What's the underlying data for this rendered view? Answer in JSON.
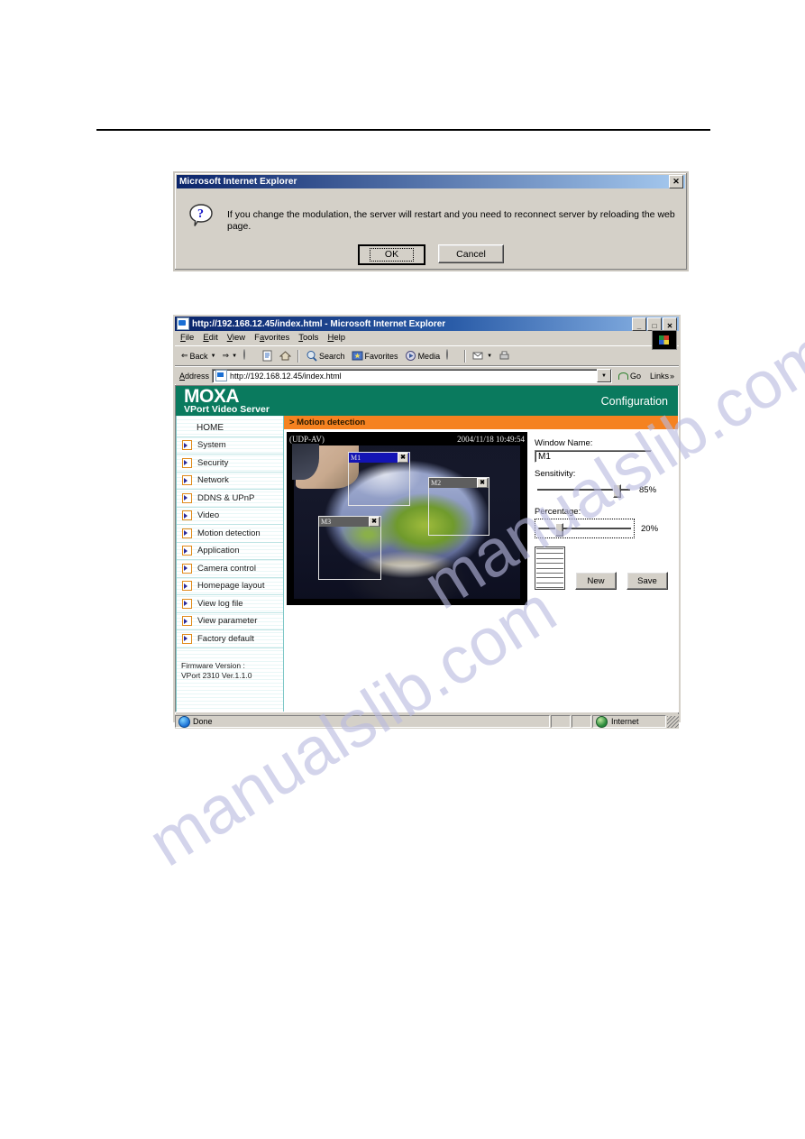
{
  "dialog": {
    "title": "Microsoft Internet Explorer",
    "close_label": "✕",
    "icon": "question-balloon-icon",
    "message": "If you change the modulation, the server will restart and you need to reconnect server by reloading the web page.",
    "ok_label": "OK",
    "cancel_label": "Cancel"
  },
  "browser": {
    "title": "http://192.168.12.45/index.html - Microsoft Internet Explorer",
    "window_buttons": {
      "minimize": "_",
      "maximize": "□",
      "close": "✕"
    },
    "menu": [
      "File",
      "Edit",
      "View",
      "Favorites",
      "Tools",
      "Help"
    ],
    "toolbar": {
      "back": "Back",
      "forward": "",
      "stop": "",
      "refresh": "",
      "home": "",
      "search": "Search",
      "favorites": "Favorites",
      "media": "Media",
      "history": "",
      "mail": "",
      "print": ""
    },
    "address": {
      "label": "Address",
      "value": "http://192.168.12.45/index.html",
      "go_label": "Go",
      "links_label": "Links"
    },
    "status": {
      "text": "Done",
      "zone": "Internet"
    }
  },
  "page": {
    "brand": "MOXA",
    "brand_sub": "VPort Video Server",
    "header_right": "Configuration",
    "section_title": "> Motion detection",
    "sidebar": {
      "items": [
        {
          "label": "HOME",
          "icon": ""
        },
        {
          "label": "System",
          "icon": "arrow-box-icon"
        },
        {
          "label": "Security",
          "icon": "arrow-box-icon"
        },
        {
          "label": "Network",
          "icon": "arrow-box-icon"
        },
        {
          "label": "DDNS & UPnP",
          "icon": "arrow-box-icon"
        },
        {
          "label": "Video",
          "icon": "arrow-box-icon"
        },
        {
          "label": "Motion detection",
          "icon": "arrow-box-icon"
        },
        {
          "label": "Application",
          "icon": "arrow-box-icon"
        },
        {
          "label": "Camera control",
          "icon": "arrow-box-icon"
        },
        {
          "label": "Homepage layout",
          "icon": "arrow-box-icon"
        },
        {
          "label": "View log file",
          "icon": "arrow-box-icon"
        },
        {
          "label": "View parameter",
          "icon": "arrow-box-icon"
        },
        {
          "label": "Factory default",
          "icon": "arrow-box-icon"
        }
      ],
      "firmware_label": "Firmware Version :",
      "firmware_value": "VPort 2310 Ver.1.1.0"
    },
    "video": {
      "protocol": "(UDP-AV)",
      "timestamp": "2004/11/18 10:49:54",
      "windows": [
        {
          "name": "M1",
          "state": "active",
          "close": "✖"
        },
        {
          "name": "M2",
          "state": "inactive",
          "close": "✖"
        },
        {
          "name": "M3",
          "state": "inactive",
          "close": "✖"
        }
      ]
    },
    "controls": {
      "window_name_label": "Window Name:",
      "window_name_value": "M1",
      "sensitivity_label": "Sensitivity:",
      "sensitivity_value": "85%",
      "sensitivity_percent": 85,
      "percentage_label": "Percentage:",
      "percentage_value": "20%",
      "percentage_percent": 20,
      "new_label": "New",
      "save_label": "Save"
    }
  },
  "watermark": {
    "text_a": "manualslib.com",
    "text_b": "manualslib.com"
  },
  "colors": {
    "brand_green": "#0a7a5e",
    "section_orange": "#f58220",
    "title_blue": "#0a246a",
    "active_window": "#1414b4",
    "chrome_gray": "#d4d0c8"
  }
}
